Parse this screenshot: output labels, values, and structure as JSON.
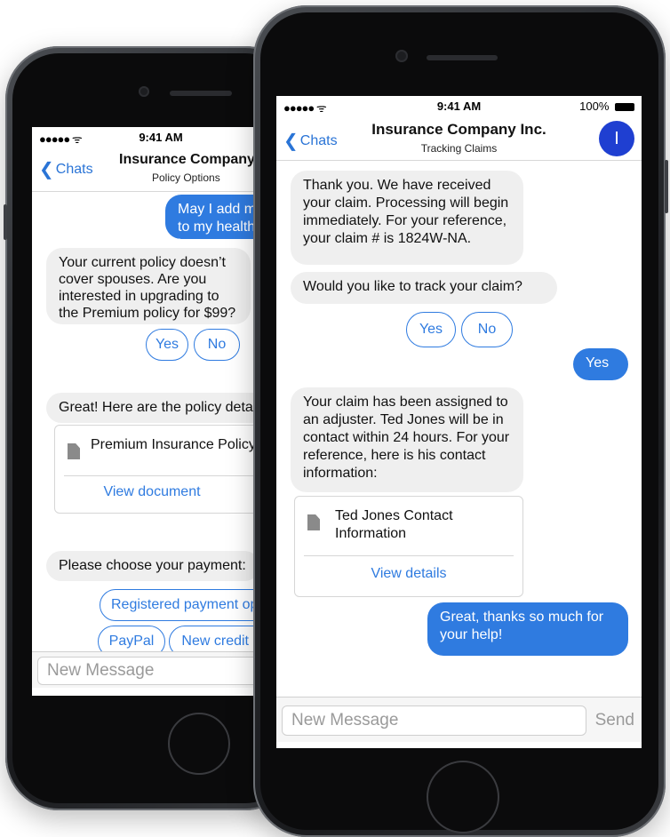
{
  "back_phone": {
    "status": {
      "signal": "●●●●● ᯤ",
      "time": "9:41 AM"
    },
    "nav": {
      "back_label": "Chats",
      "title": "Insurance Company Inc.",
      "subtitle": "Policy Options"
    },
    "messages": {
      "m1": "May I add my wife to my health insurance?",
      "m2": "Your current policy doesn’t cover spouses. Are you interested in upgrading to the Premium policy for $99?",
      "m3": "Great! Here are the policy details:",
      "m4": "Please choose your payment:"
    },
    "quick_replies": {
      "yes": "Yes",
      "no": "No"
    },
    "document": {
      "title": "Premium Insurance Policy",
      "link": "View document"
    },
    "payment_options": {
      "registered": "Registered payment option",
      "paypal": "PayPal",
      "new_card": "New credit card"
    },
    "input": {
      "placeholder": "New Message"
    }
  },
  "front_phone": {
    "status": {
      "signal": "●●●●● ᯤ",
      "time": "9:41 AM",
      "battery": "100%"
    },
    "nav": {
      "back_label": "Chats",
      "title": "Insurance Company Inc.",
      "subtitle": "Tracking Claims",
      "avatar_initial": "I"
    },
    "messages": {
      "m1": "Thank you. We have received your claim. Processing will begin immediately. For your reference, your claim # is 1824W-NA.",
      "m2": "Would you like to track your claim?",
      "m3": "Yes",
      "m4": "Your claim has been assigned to an adjuster. Ted Jones will be in contact within 24 hours. For your reference, here is his contact information:",
      "m5": "Great, thanks so much for your help!"
    },
    "quick_replies": {
      "yes": "Yes",
      "no": "No"
    },
    "contact_card": {
      "title": "Ted Jones Contact Information",
      "link": "View details"
    },
    "input": {
      "placeholder": "New Message",
      "send_label": "Send"
    }
  },
  "colors": {
    "accent": "#2f7be0",
    "incoming_bubble": "#efefef",
    "avatar": "#1f3fd1"
  }
}
